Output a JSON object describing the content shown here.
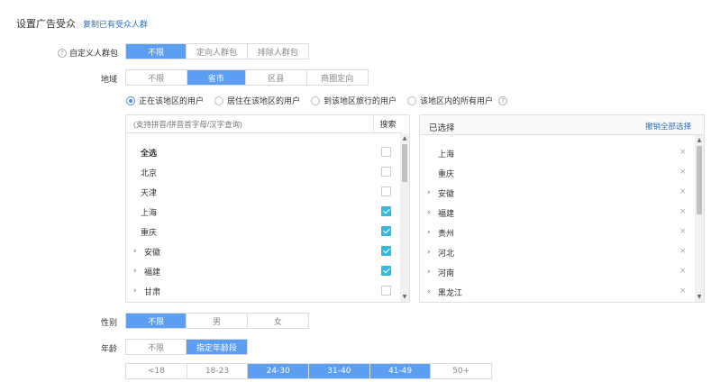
{
  "header": {
    "title": "设置广告受众",
    "copy_link": "复制已有受众人群"
  },
  "custom_audience": {
    "label": "自定义人群包",
    "options": [
      "不限",
      "定向人群包",
      "排除人群包"
    ],
    "selected": 0
  },
  "region": {
    "label": "地域",
    "options": [
      "不限",
      "省市",
      "区县",
      "商圈定向"
    ],
    "selected": 1,
    "scope": [
      "正在该地区的用户",
      "居住在该地区的用户",
      "到该地区旅行的用户",
      "该地区内的所有用户"
    ],
    "scope_selected": 0
  },
  "left_panel": {
    "search_placeholder": "(支持拼音/拼音首字母/汉字查询)",
    "search_button": "搜索",
    "items": [
      {
        "label": "全选",
        "checked": false,
        "expandable": false
      },
      {
        "label": "北京",
        "checked": false,
        "expandable": false
      },
      {
        "label": "天津",
        "checked": false,
        "expandable": false
      },
      {
        "label": "上海",
        "checked": true,
        "expandable": false
      },
      {
        "label": "重庆",
        "checked": true,
        "expandable": false
      },
      {
        "label": "安徽",
        "checked": true,
        "expandable": true
      },
      {
        "label": "福建",
        "checked": true,
        "expandable": true
      },
      {
        "label": "甘肃",
        "checked": false,
        "expandable": true
      }
    ]
  },
  "right_panel": {
    "title": "已选择",
    "clear_all": "撤销全部选择",
    "items": [
      {
        "label": "上海",
        "expandable": false
      },
      {
        "label": "重庆",
        "expandable": false
      },
      {
        "label": "安徽",
        "expandable": true
      },
      {
        "label": "福建",
        "expandable": true
      },
      {
        "label": "贵州",
        "expandable": true
      },
      {
        "label": "河北",
        "expandable": true
      },
      {
        "label": "河南",
        "expandable": true
      },
      {
        "label": "黑龙江",
        "expandable": true
      }
    ],
    "delete_glyph": "×"
  },
  "gender": {
    "label": "性别",
    "options": [
      "不限",
      "男",
      "女"
    ],
    "selected": 0
  },
  "age": {
    "label": "年龄",
    "options": [
      "不限",
      "指定年龄段"
    ],
    "selected": 1,
    "ranges": [
      "<18",
      "18-23",
      "24-30",
      "31-40",
      "41-49",
      "50+"
    ],
    "ranges_selected": [
      2,
      3,
      4
    ]
  },
  "colors": {
    "accent": "#5b9ef2",
    "checkbox": "#36b9e0",
    "link": "#2f6fb5"
  },
  "icons": {
    "help": "?",
    "expand": "›"
  }
}
